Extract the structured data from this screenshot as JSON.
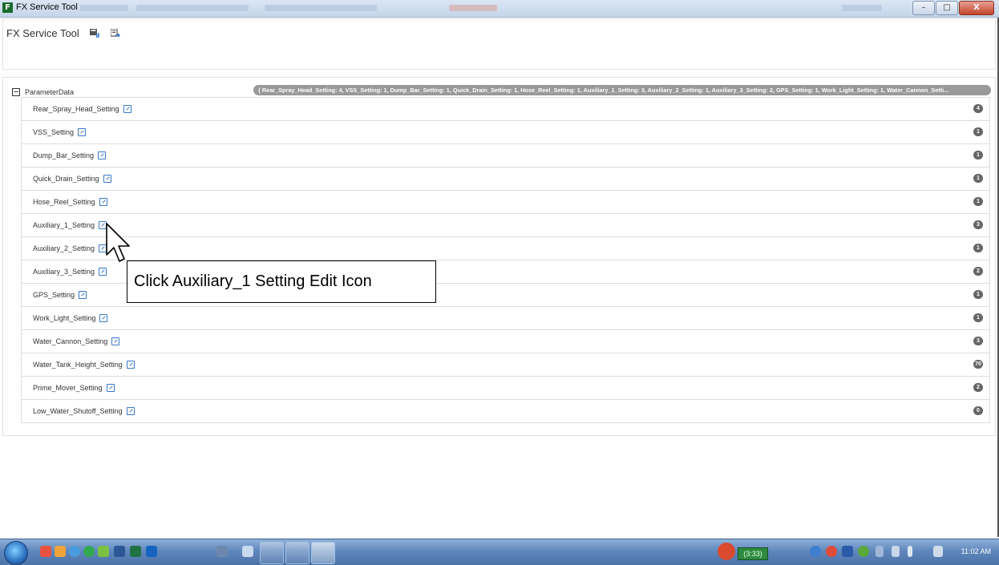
{
  "window": {
    "title": "FX Service Tool",
    "controls": [
      "–",
      "□",
      "X"
    ]
  },
  "header": {
    "title": "FX Service Tool",
    "icons": [
      "save-icon",
      "export-icon"
    ]
  },
  "tree": {
    "root": {
      "label": "ParameterData",
      "expander": "−",
      "summary": "{ Rear_Spray_Head_Setting: 4, VSS_Setting: 1, Dump_Bar_Setting: 1, Quick_Drain_Setting: 1, Hose_Reel_Setting: 1, Auxiliary_1_Setting: 3, Auxiliary_2_Setting: 1, Auxiliary_3_Setting: 2, GPS_Setting: 1, Work_Light_Setting: 1, Water_Cannon_Setti..."
    },
    "items": [
      {
        "label": "Rear_Spray_Head_Setting",
        "count": "4"
      },
      {
        "label": "VSS_Setting",
        "count": "1"
      },
      {
        "label": "Dump_Bar_Setting",
        "count": "1"
      },
      {
        "label": "Quick_Drain_Setting",
        "count": "1"
      },
      {
        "label": "Hose_Reel_Setting",
        "count": "1"
      },
      {
        "label": "Auxiliary_1_Setting",
        "count": "3"
      },
      {
        "label": "Auxiliary_2_Setting",
        "count": "1"
      },
      {
        "label": "Auxiliary_3_Setting",
        "count": "2"
      },
      {
        "label": "GPS_Setting",
        "count": "1"
      },
      {
        "label": "Work_Light_Setting",
        "count": "1"
      },
      {
        "label": "Water_Cannon_Setting",
        "count": "3"
      },
      {
        "label": "Water_Tank_Height_Setting",
        "count": "70"
      },
      {
        "label": "Prime_Mover_Setting",
        "count": "2"
      },
      {
        "label": "Low_Water_Shutoff_Setting",
        "count": "0"
      }
    ]
  },
  "annotation": {
    "text": "Click Auxiliary_1 Setting Edit Icon"
  },
  "taskbar": {
    "battery": "(3:33)",
    "clock": "11:02 AM"
  }
}
